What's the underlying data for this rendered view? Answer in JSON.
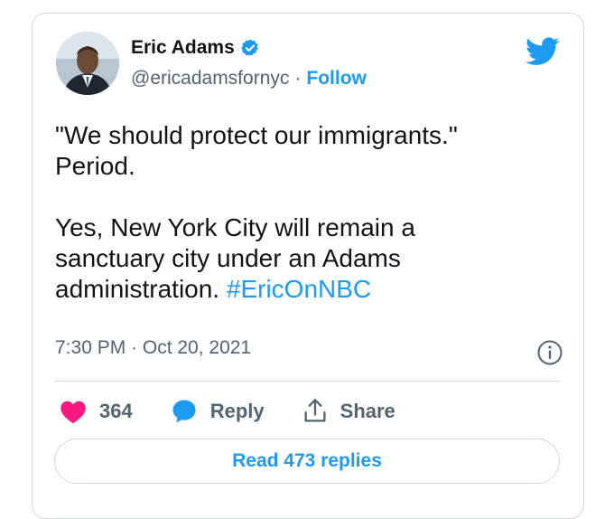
{
  "author": {
    "name": "Eric Adams",
    "handle": "@ericadamsfornyc",
    "separator": "·",
    "follow_label": "Follow"
  },
  "tweet": {
    "paragraph1": "\"We should protect our immigrants.\"\nPeriod.",
    "paragraph2_text": "Yes, New York City will remain a\nsanctuary city under an Adams\nadministration. ",
    "hashtag": "#EricOnNBC",
    "timestamp": "7:30 PM · Oct 20, 2021"
  },
  "actions": {
    "likes": "364",
    "reply_label": "Reply",
    "share_label": "Share"
  },
  "read_replies_label": "Read 473 replies",
  "colors": {
    "accent": "#1d9bf0",
    "like": "#f91880",
    "text": "#0f1419",
    "muted": "#536471",
    "border": "#cfd9de"
  },
  "icons": [
    "verified-badge-icon",
    "twitter-bird-icon",
    "info-icon",
    "heart-icon",
    "reply-bubble-icon",
    "share-icon"
  ]
}
